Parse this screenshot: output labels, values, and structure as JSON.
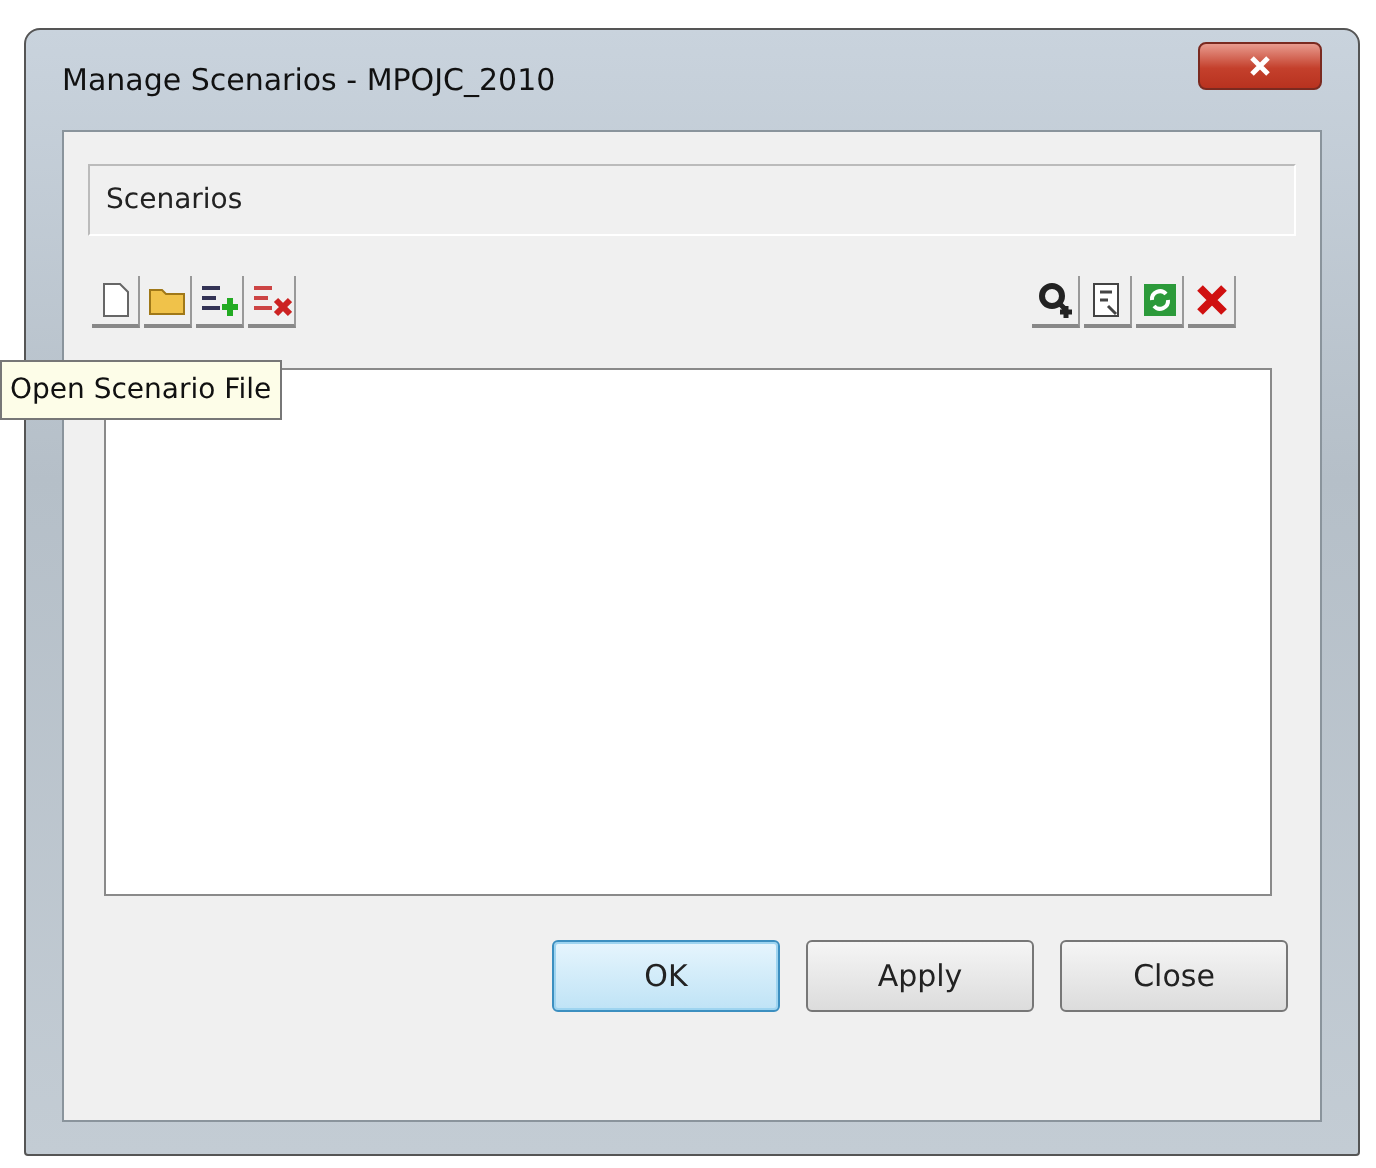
{
  "window": {
    "title": "Manage Scenarios - MPOJC_2010"
  },
  "header": {
    "label": "Scenarios"
  },
  "toolbar_left": [
    {
      "kind": "new"
    },
    {
      "kind": "open"
    },
    {
      "kind": "add"
    },
    {
      "kind": "remove"
    }
  ],
  "toolbar_right": [
    {
      "kind": "find"
    },
    {
      "kind": "edit"
    },
    {
      "kind": "refresh"
    },
    {
      "kind": "delete"
    }
  ],
  "tooltip": "Open Scenario File",
  "buttons": [
    {
      "label": "OK",
      "default": true
    },
    {
      "label": "Apply",
      "default": false
    },
    {
      "label": "Close",
      "default": false
    }
  ]
}
